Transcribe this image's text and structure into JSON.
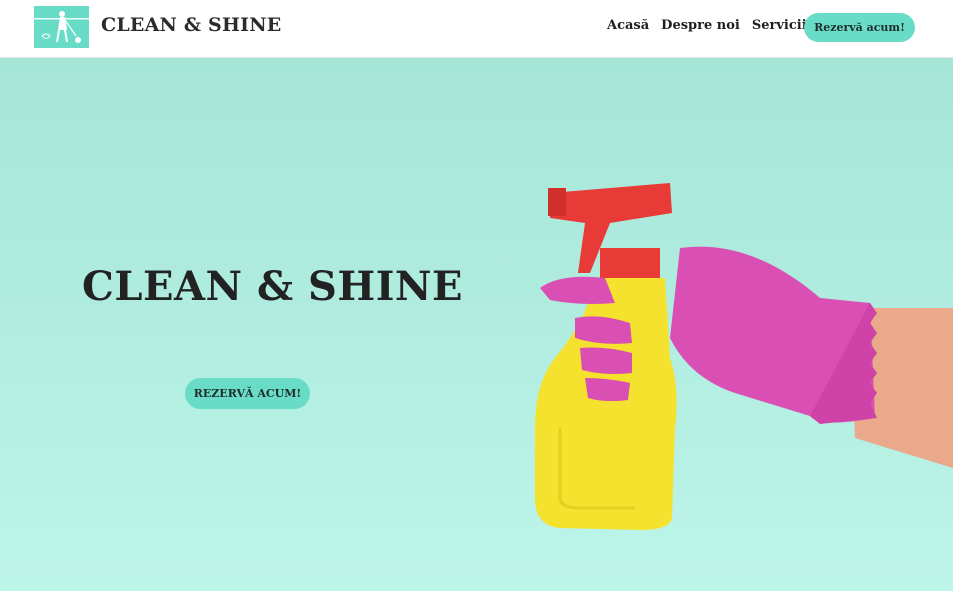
{
  "header": {
    "brand": "CLEAN & SHINE",
    "logo_icon": "cleaning-person-logo",
    "nav": [
      "Acasă",
      "Despre noi",
      "Servicii"
    ],
    "cta_label": "Rezervă acum!"
  },
  "hero": {
    "title": "CLEAN & SHINE",
    "cta_label": "REZERVĂ ACUM!",
    "image_icon": "spray-bottle-glove-image"
  },
  "colors": {
    "accent": "#68dcc6",
    "hero_background": "#b0ecdf",
    "glove": "#d94fb4",
    "bottle": "#f4e22e",
    "nozzle": "#e83a36"
  }
}
